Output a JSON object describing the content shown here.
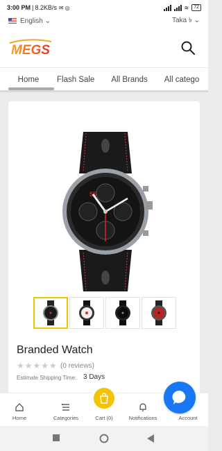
{
  "status_bar": {
    "time": "3:00 PM",
    "speed": "8.2KB/s",
    "battery": "72"
  },
  "locale_bar": {
    "language": "English",
    "currency": "Taka ৳"
  },
  "header": {
    "logo_text": "MEGS"
  },
  "nav": {
    "tabs": [
      "Home",
      "Flash Sale",
      "All Brands",
      "All catego"
    ]
  },
  "product": {
    "name": "Branded Watch",
    "stars": "★★★★★",
    "reviews": "(0 reviews)",
    "shipping_label": "Estimate Shipping Time:",
    "shipping_value": "3 Days",
    "accent_color": "#f0c400"
  },
  "bottom_nav": {
    "home": "Home",
    "categories": "Categories",
    "cart": "Cart (0)",
    "notifications": "Notifications",
    "account": "Account"
  },
  "colors": {
    "cart_button": "#f4c400",
    "chat_button": "#1877f2",
    "logo_red": "#e8342a",
    "logo_orange": "#f5a623"
  },
  "icons": [
    "search-icon",
    "home-icon",
    "categories-icon",
    "cart-icon",
    "bell-icon",
    "chat-icon",
    "back-icon",
    "home-circle-icon",
    "recents-icon"
  ]
}
